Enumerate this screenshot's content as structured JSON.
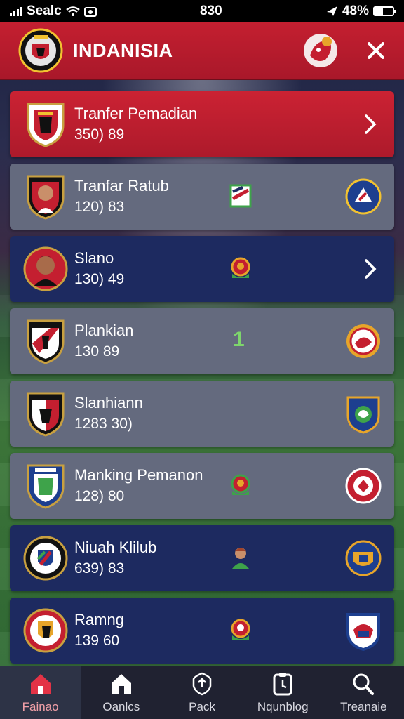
{
  "status_bar": {
    "carrier": "Sealc",
    "time": "830",
    "battery_percent": "48%"
  },
  "header": {
    "title": "INDANISIA"
  },
  "rows": [
    {
      "title": "Tranfer Pemadian",
      "subtitle": "350) 89",
      "style": "red",
      "right": "chevron"
    },
    {
      "title": "Tranfar Ratub",
      "subtitle": "120) 83",
      "style": "grey",
      "right": "crest"
    },
    {
      "title": "Slano",
      "subtitle": "130) 49",
      "style": "navy",
      "right": "chevron"
    },
    {
      "title": "Plankian",
      "subtitle": "130 89",
      "style": "grey",
      "right": "crest",
      "mid_value": "1"
    },
    {
      "title": "Slanhiann",
      "subtitle": "1283 30)",
      "style": "grey",
      "right": "crest"
    },
    {
      "title": "Manking Pemanon",
      "subtitle": "128) 80",
      "style": "grey",
      "right": "crest"
    },
    {
      "title": "Niuah Klilub",
      "subtitle": "639) 83",
      "style": "navy",
      "right": "crest"
    },
    {
      "title": "Ramng",
      "subtitle": "139 60",
      "style": "navy",
      "right": "crest"
    }
  ],
  "bottom_nav": [
    {
      "label": "Fainao",
      "icon": "home-icon",
      "active": true
    },
    {
      "label": "Oanlcs",
      "icon": "home-icon",
      "active": false
    },
    {
      "label": "Pack",
      "icon": "shield-icon",
      "active": false
    },
    {
      "label": "Nqunblog",
      "icon": "clipboard-icon",
      "active": false
    },
    {
      "label": "Treanaie",
      "icon": "search-icon",
      "active": false
    }
  ],
  "colors": {
    "header_red": "#c41f30",
    "row_grey": "#646a7e",
    "row_navy": "#1d2a60",
    "accent_green": "#7ed66c"
  }
}
